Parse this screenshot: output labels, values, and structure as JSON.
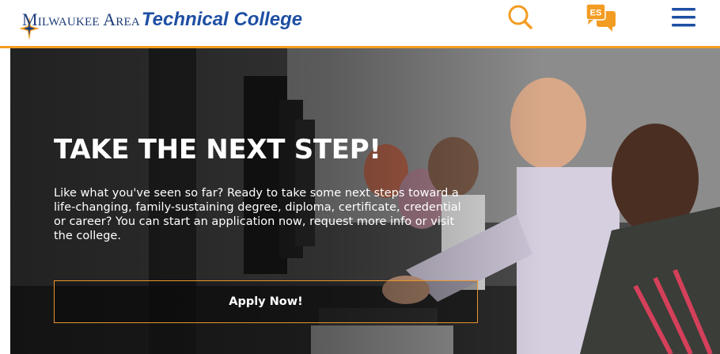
{
  "header": {
    "logo": {
      "part1": "Milwaukee Area",
      "part2": "Technical College"
    },
    "icons": [
      "search-icon",
      "spanish-language-icon",
      "hamburger-menu-icon"
    ],
    "language_badge": "ES",
    "colors": {
      "brand_blue": "#1e4fa3",
      "accent_orange": "#f39c23"
    }
  },
  "hero": {
    "title": "TAKE THE NEXT STEP!",
    "body": "Like what you've seen so far? Ready to take some next steps toward a life-changing, family-sustaining degree, diploma, certificate, credential or career? You can start an application now, request more info or visit the college.",
    "cta_label": "Apply Now!"
  }
}
